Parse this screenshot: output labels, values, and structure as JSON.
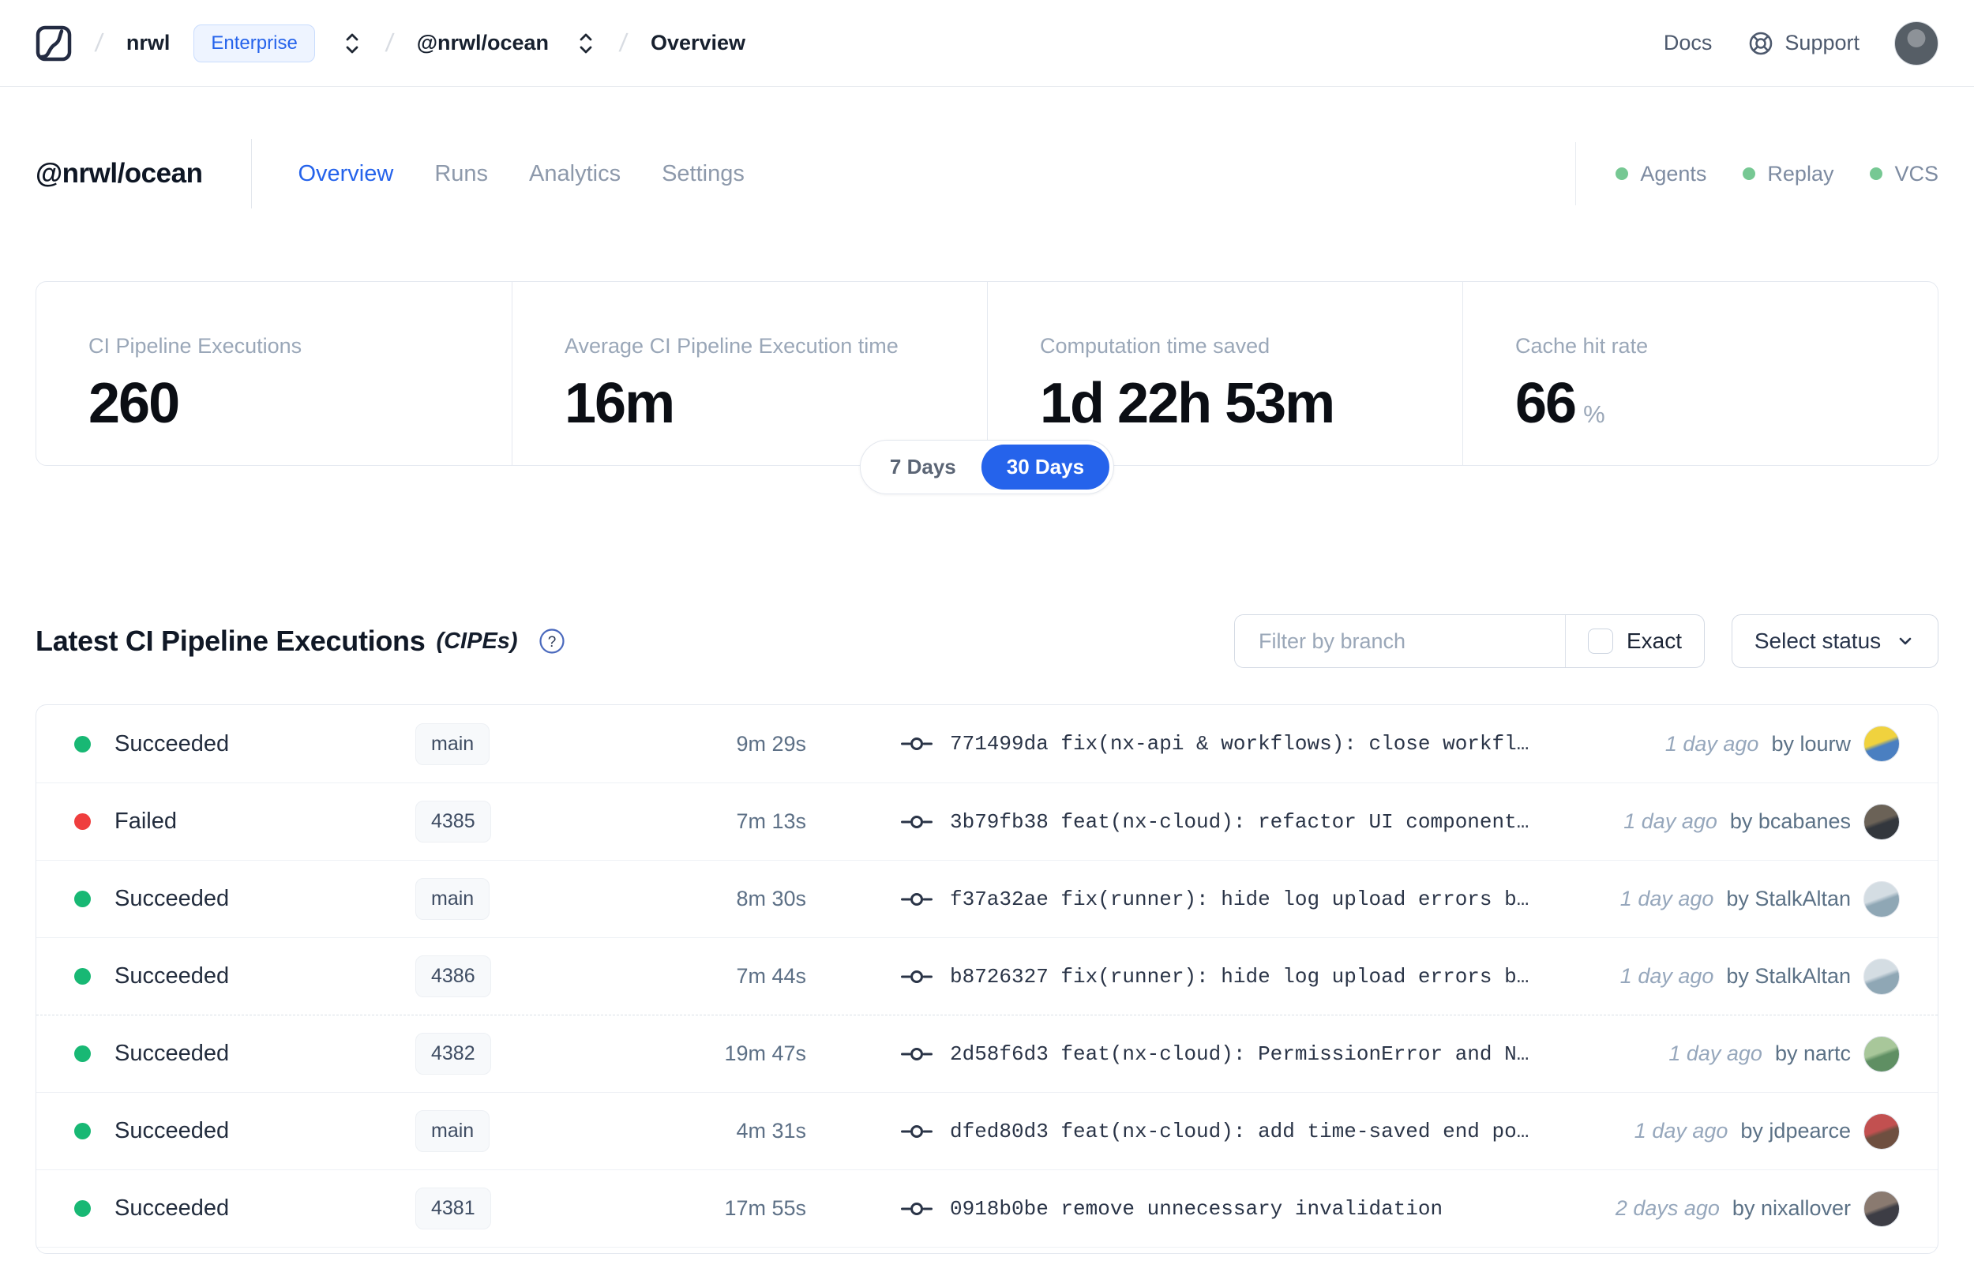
{
  "nav": {
    "breadcrumb": {
      "slash": "/",
      "org": "nrwl",
      "org_badge": "Enterprise",
      "workspace": "@nrwl/ocean",
      "page": "Overview"
    },
    "docs_label": "Docs",
    "support_label": "Support"
  },
  "header": {
    "title": "@nrwl/ocean",
    "tabs": {
      "overview": "Overview",
      "runs": "Runs",
      "analytics": "Analytics",
      "settings": "Settings"
    },
    "statuses": {
      "agents": "Agents",
      "replay": "Replay",
      "vcs": "VCS"
    }
  },
  "stats": {
    "cards": [
      {
        "label": "CI Pipeline Executions",
        "value": "260",
        "suffix": ""
      },
      {
        "label": "Average CI Pipeline Execution time",
        "value": "16m",
        "suffix": ""
      },
      {
        "label": "Computation time saved",
        "value": "1d 22h 53m",
        "suffix": ""
      },
      {
        "label": "Cache hit rate",
        "value": "66",
        "suffix": "%"
      }
    ],
    "range_toggle": {
      "option_7": "7 Days",
      "option_30": "30 Days",
      "selected": "30 Days"
    }
  },
  "cipe": {
    "title": "Latest CI Pipeline Executions",
    "title_suffix": "(CIPEs)",
    "filter": {
      "branch_placeholder": "Filter by branch",
      "exact_label": "Exact",
      "status_select_label": "Select status"
    },
    "rows": [
      {
        "status": "Succeeded",
        "branch": "main",
        "duration": "9m 29s",
        "commit": "771499da fix(nx-api & workflows): close workfl…",
        "time": "1 day ago",
        "author": "by lourw",
        "avatar_colors": [
          "#f0d23e",
          "#4a7fc1"
        ]
      },
      {
        "status": "Failed",
        "branch": "4385",
        "duration": "7m 13s",
        "commit": "3b79fb38 feat(nx-cloud): refactor UI component…",
        "time": "1 day ago",
        "author": "by bcabanes",
        "avatar_colors": [
          "#6b6257",
          "#33373d"
        ]
      },
      {
        "status": "Succeeded",
        "branch": "main",
        "duration": "8m 30s",
        "commit": "f37a32ae fix(runner): hide log upload errors b…",
        "time": "1 day ago",
        "author": "by StalkAltan",
        "avatar_colors": [
          "#d4dde3",
          "#8fa7b5"
        ]
      },
      {
        "status": "Succeeded",
        "branch": "4386",
        "duration": "7m 44s",
        "commit": "b8726327 fix(runner): hide log upload errors b…",
        "time": "1 day ago",
        "author": "by StalkAltan",
        "avatar_colors": [
          "#d4dde3",
          "#8fa7b5"
        ]
      },
      {
        "status": "Succeeded",
        "branch": "4382",
        "duration": "19m 47s",
        "commit": "2d58f6d3 feat(nx-cloud): PermissionError and N…",
        "time": "1 day ago",
        "author": "by nartc",
        "avatar_colors": [
          "#a8c79a",
          "#5f8f63"
        ]
      },
      {
        "status": "Succeeded",
        "branch": "main",
        "duration": "4m 31s",
        "commit": "dfed80d3 feat(nx-cloud): add time-saved end po…",
        "time": "1 day ago",
        "author": "by jdpearce",
        "avatar_colors": [
          "#c25050",
          "#6e4f40"
        ]
      },
      {
        "status": "Succeeded",
        "branch": "4381",
        "duration": "17m 55s",
        "commit": "0918b0be remove unnecessary invalidation",
        "time": "2 days ago",
        "author": "by nixallover",
        "avatar_colors": [
          "#8a7a70",
          "#3d3d45"
        ]
      }
    ]
  },
  "colors": {
    "accent_blue": "#2563eb",
    "success_green": "#18b874",
    "failed_red": "#ef3e3e",
    "header_status_green": "#76c893"
  }
}
